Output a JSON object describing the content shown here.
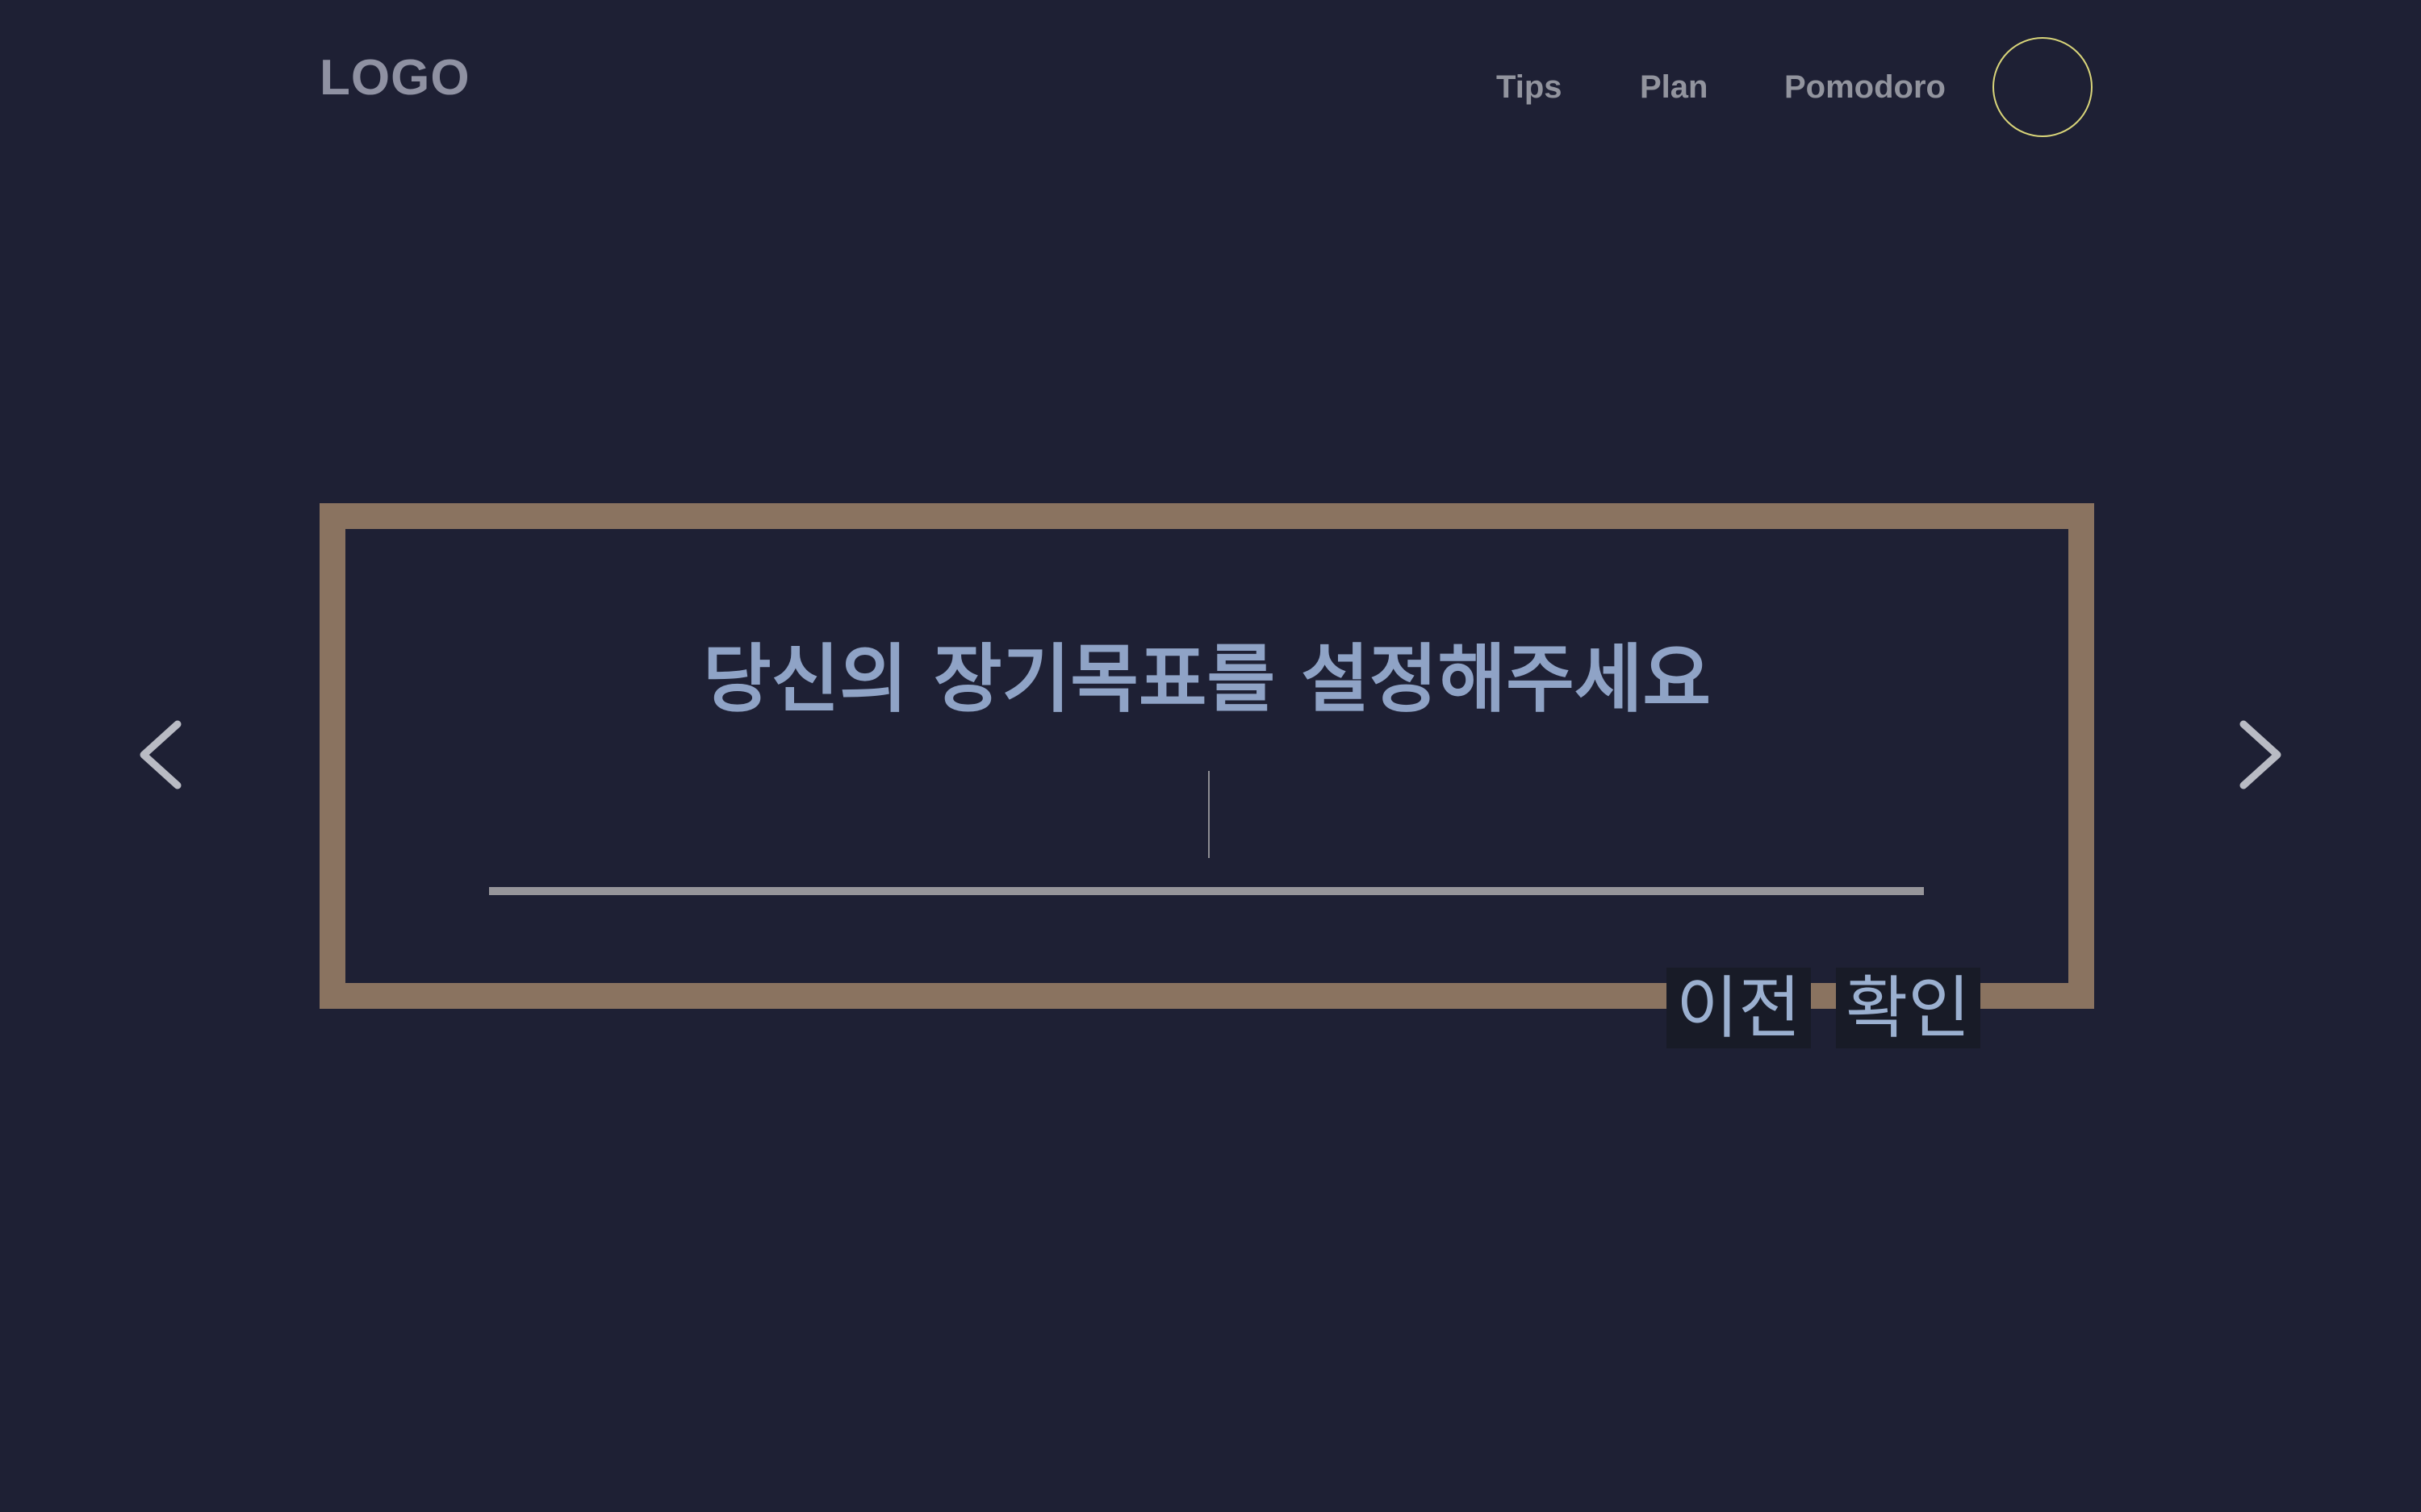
{
  "header": {
    "logo": "LOGO",
    "nav": [
      {
        "label": "Tips"
      },
      {
        "label": "Plan"
      },
      {
        "label": "Pomodoro"
      }
    ]
  },
  "main": {
    "title": "당신의 장기목표를 설정해주세요",
    "input_value": "",
    "input_placeholder": "",
    "buttons": {
      "prev": "이전",
      "confirm": "확인"
    }
  },
  "icons": {
    "left": "chevron-left-icon",
    "right": "chevron-right-icon"
  },
  "colors": {
    "background": "#1e2034",
    "frame": "#8a7360",
    "title": "#8fa3c6",
    "profile_ring": "#d9d57a",
    "underline": "#96959a"
  }
}
